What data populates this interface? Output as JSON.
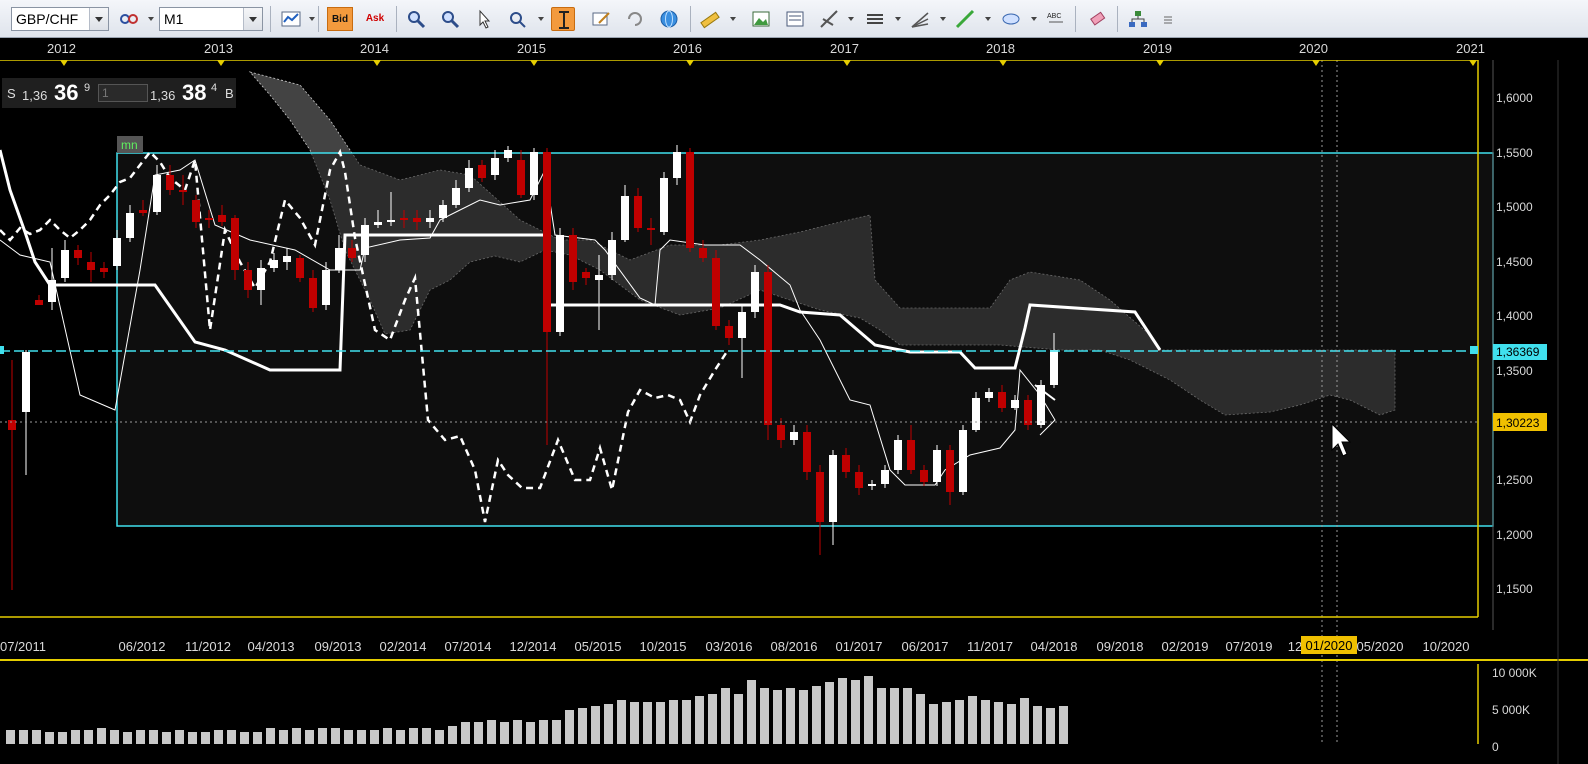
{
  "toolbar": {
    "symbol": "GBP/CHF",
    "timeframe": "M1",
    "bid_label": "Bid",
    "ask_label": "Ask"
  },
  "price_panel": {
    "sell_label": "S",
    "sell_prefix": "1,36",
    "sell_big": "36",
    "sell_sup": "9",
    "lot": "1",
    "buy_prefix": "1,36",
    "buy_big": "38",
    "buy_sup": "4",
    "buy_label": "B"
  },
  "top_years": [
    "2012",
    "2013",
    "2014",
    "2015",
    "2016",
    "2017",
    "2018",
    "2019",
    "2020",
    "2021"
  ],
  "bottom_dates": [
    "07/2011",
    "06/2012",
    "11/2012",
    "04/2013",
    "09/2013",
    "02/2014",
    "07/2014",
    "12/2014",
    "05/2015",
    "10/2015",
    "03/2016",
    "08/2016",
    "01/2017",
    "06/2017",
    "11/2017",
    "04/2018",
    "09/2018",
    "02/2019",
    "07/2019",
    "12",
    "01/2020",
    "05/2020",
    "10/2020"
  ],
  "cursor_date": "01/2020",
  "price_labels": [
    "1,6000",
    "1,5500",
    "1,5000",
    "1,4500",
    "1,4000",
    "1,3500",
    "1,3000",
    "1,2500",
    "1,2000",
    "1,1500"
  ],
  "current_price_label": "1,36369",
  "crosshair_price_label": "1,30223",
  "rect_tag": "mn",
  "volume_labels": [
    "10 000K",
    "5 000K",
    "0"
  ],
  "colors": {
    "bull": "#ffffff",
    "bear": "#c00000",
    "cloud": "#4a4a4a",
    "grid_frame": "#e5cd00",
    "rectangle": "#40e0ee",
    "volume": "#c8c8c8",
    "toolbar_active": "#f39a3d"
  },
  "chart_data": {
    "type": "candlestick",
    "symbol": "GBP/CHF",
    "timeframe": "monthly",
    "ylim": [
      1.13,
      1.63
    ],
    "current_price": 1.36369,
    "crosshair_price": 1.30223,
    "rectangle": {
      "top": 1.55,
      "bottom": 1.207
    },
    "volume_ylim": [
      0,
      10000
    ]
  }
}
